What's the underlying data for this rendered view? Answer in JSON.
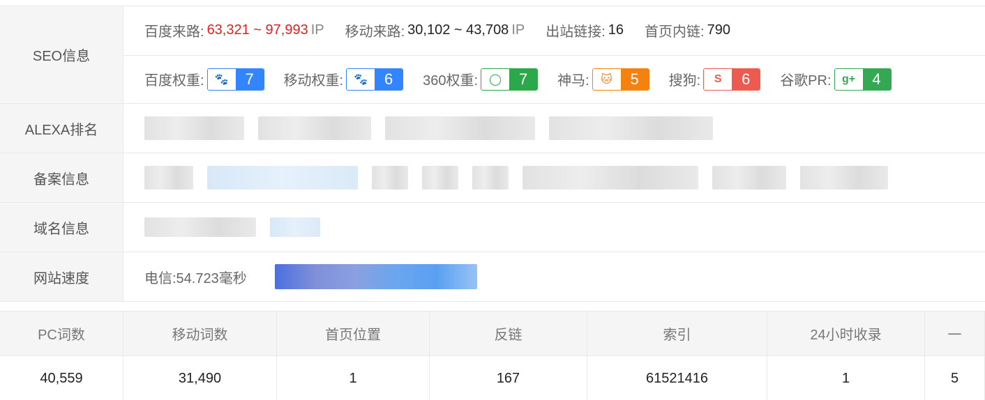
{
  "seo": {
    "label": "SEO信息",
    "line1": {
      "baidu_label": "百度来路:",
      "baidu_value": "63,321 ~ 97,993",
      "baidu_unit": "IP",
      "mobile_label": "移动来路:",
      "mobile_value": "30,102 ~ 43,708",
      "mobile_unit": "IP",
      "outlink_label": "出站链接:",
      "outlink_value": "16",
      "inlink_label": "首页内链:",
      "inlink_value": "790"
    },
    "line2": {
      "items": [
        {
          "label": "百度权重:",
          "value": "7",
          "icon": "baidu-paw-icon",
          "color": "#3385ff"
        },
        {
          "label": "移动权重:",
          "value": "6",
          "icon": "baidu-mobile-icon",
          "color": "#3385ff"
        },
        {
          "label": "360权重:",
          "value": "7",
          "icon": "360-icon",
          "color": "#2aa84a"
        },
        {
          "label": "神马:",
          "value": "5",
          "icon": "shenma-icon",
          "color": "#f5820f"
        },
        {
          "label": "搜狗:",
          "value": "6",
          "icon": "sogou-icon",
          "color": "#ee5a4f"
        },
        {
          "label": "谷歌PR:",
          "value": "4",
          "icon": "google-plus-icon",
          "color": "#35a853"
        }
      ]
    }
  },
  "alexa": {
    "label": "ALEXA排名"
  },
  "beian": {
    "label": "备案信息"
  },
  "domain": {
    "label": "域名信息"
  },
  "speed": {
    "label": "网站速度",
    "value": "电信:54.723毫秒"
  },
  "stats": {
    "headers": [
      "PC词数",
      "移动词数",
      "首页位置",
      "反链",
      "索引",
      "24小时收录",
      "一"
    ],
    "values": [
      "40,559",
      "31,490",
      "1",
      "167",
      "61521416",
      "1",
      "5"
    ]
  }
}
